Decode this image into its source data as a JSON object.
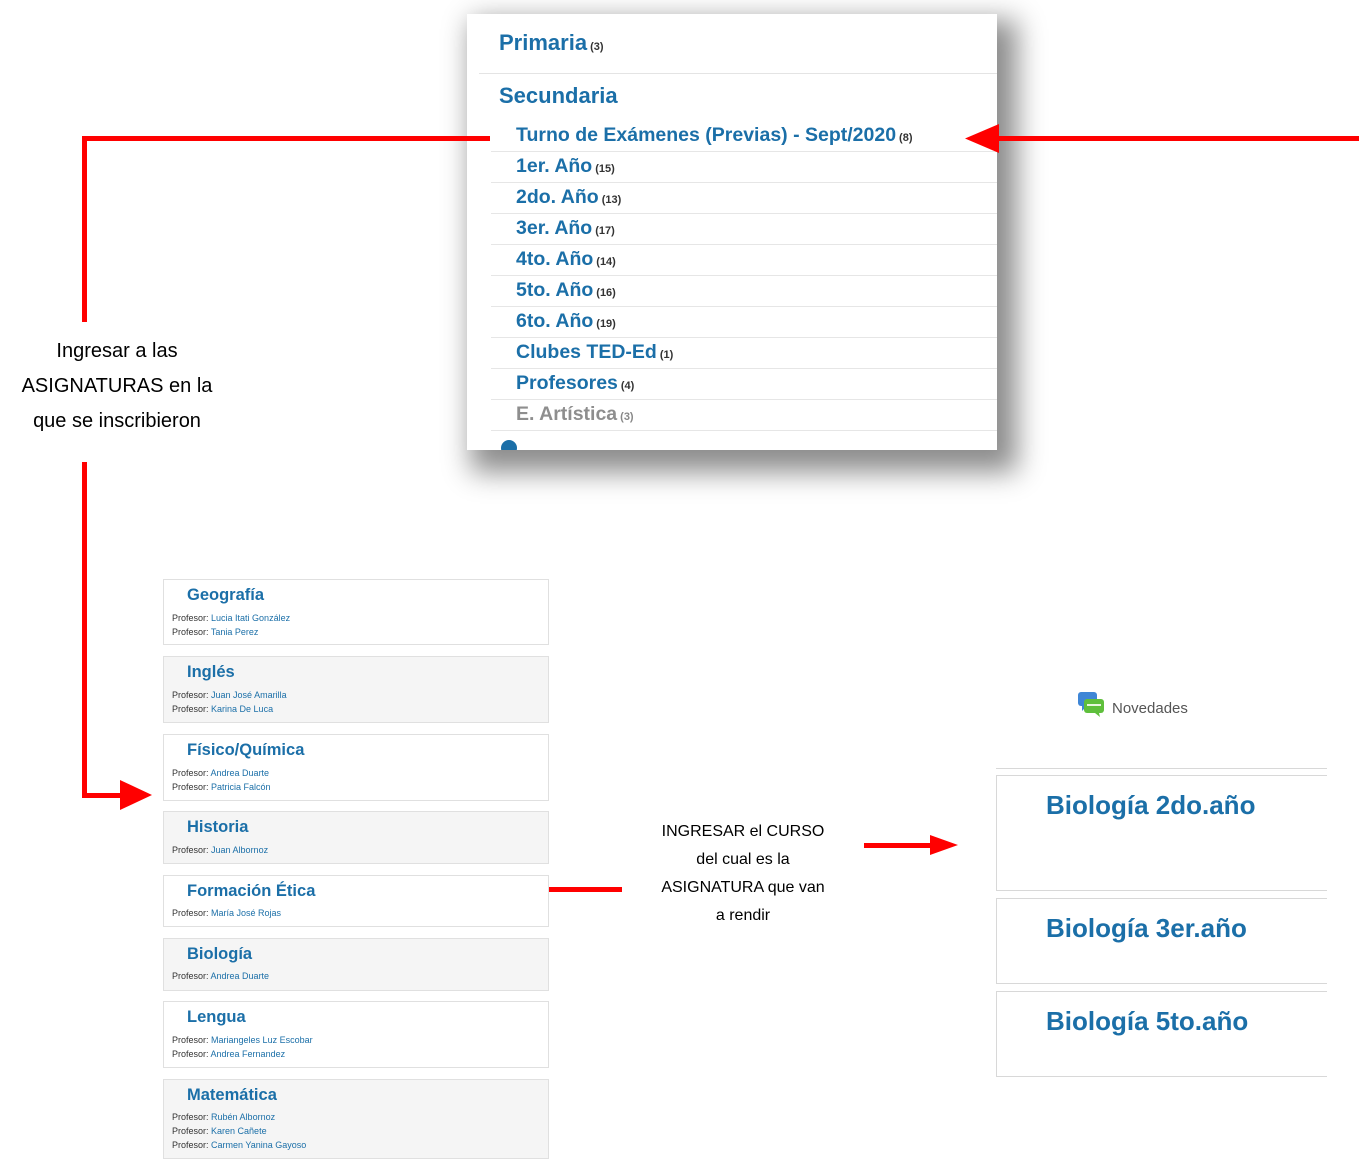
{
  "categories": {
    "primary": {
      "label": "Primaria",
      "count": "(3)"
    },
    "secondary": {
      "label": "Secundaria"
    },
    "items": [
      {
        "label": "Turno de Exámenes (Previas) - Sept/2020",
        "count": "(8)"
      },
      {
        "label": "1er. Año",
        "count": "(15)"
      },
      {
        "label": "2do. Año",
        "count": "(13)"
      },
      {
        "label": "3er. Año",
        "count": "(17)"
      },
      {
        "label": "4to. Año",
        "count": "(14)"
      },
      {
        "label": "5to. Año",
        "count": "(16)"
      },
      {
        "label": "6to. Año",
        "count": "(19)"
      },
      {
        "label": "Clubes TED-Ed",
        "count": "(1)"
      },
      {
        "label": "Profesores",
        "count": "(4)"
      },
      {
        "label": "E. Artística",
        "count": "(3)"
      }
    ]
  },
  "annotations": {
    "left": [
      "Ingresar a las",
      "ASIGNATURAS en la",
      "que se inscribieron"
    ],
    "middle": [
      "INGRESAR el CURSO",
      "del cual es la",
      "ASIGNATURA que van",
      "a rendir"
    ]
  },
  "subjects": [
    {
      "title": "Geografía",
      "teachers": [
        "Lucia Itati González",
        "Tania Perez"
      ]
    },
    {
      "title": "Inglés",
      "teachers": [
        "Juan José Amarilla",
        "Karina De Luca"
      ]
    },
    {
      "title": "Físico/Química",
      "teachers": [
        "Andrea Duarte",
        "Patricia Falcón"
      ]
    },
    {
      "title": "Historia",
      "teachers": [
        "Juan Albornoz"
      ]
    },
    {
      "title": "Formación Ética",
      "teachers": [
        "María José Rojas"
      ]
    },
    {
      "title": "Biología",
      "teachers": [
        "Andrea Duarte"
      ]
    },
    {
      "title": "Lengua",
      "teachers": [
        "Mariangeles Luz Escobar",
        "Andrea Fernandez"
      ]
    },
    {
      "title": "Matemática",
      "teachers": [
        "Rubén Albornoz",
        "Karen Cañete",
        "Carmen Yanina Gayoso"
      ]
    }
  ],
  "professor_prefix": "Profesor:",
  "news": {
    "label": "Novedades",
    "icon": "chat-bubbles-icon"
  },
  "courses": [
    {
      "title": "Biología 2do.año"
    },
    {
      "title": "Biología 3er.año"
    },
    {
      "title": "Biología 5to.año"
    }
  ],
  "colors": {
    "link": "#1b6fa8",
    "arrow": "#ff0000"
  }
}
